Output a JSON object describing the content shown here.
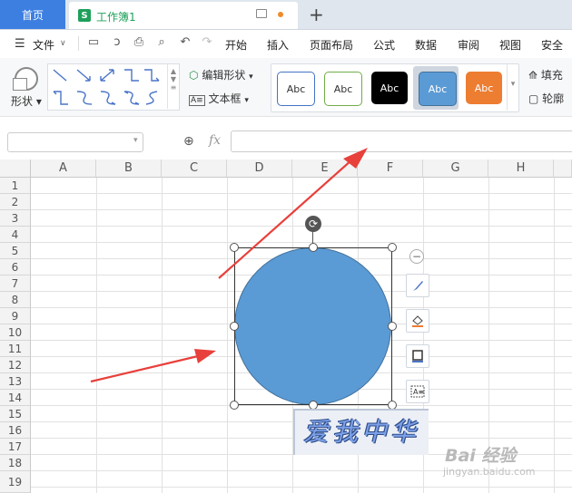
{
  "titlebar": {
    "home_tab": "首页",
    "doc_icon": "S",
    "doc_title": "工作簿1",
    "new_tab_symbol": "+"
  },
  "menubar": {
    "file_label": "文件",
    "items": [
      "开始",
      "插入",
      "页面布局",
      "公式",
      "数据",
      "审阅",
      "视图",
      "安全"
    ]
  },
  "ribbon": {
    "shape_label": "形状",
    "edit_shape_label": "编辑形状",
    "textbox_label": "文本框",
    "style_samples": [
      "Abc",
      "Abc",
      "Abc",
      "Abc",
      "Abc"
    ],
    "style_colors": {
      "style1_border": "#4472c4",
      "style2_border": "#70ad47",
      "style3_fill": "#000000",
      "style4_fill": "#5b9bd5",
      "style5_fill": "#ed7d31"
    },
    "fill_label": "填充",
    "outline_label": "轮廓"
  },
  "formula_bar": {
    "fx_label": "fx",
    "cell_reference": "",
    "formula_value": ""
  },
  "grid": {
    "columns": [
      "A",
      "B",
      "C",
      "D",
      "E",
      "F",
      "G",
      "H"
    ],
    "rows": [
      "1",
      "2",
      "3",
      "4",
      "5",
      "6",
      "7",
      "8",
      "9",
      "10",
      "11",
      "12",
      "13",
      "14",
      "15",
      "16",
      "17",
      "18",
      "19"
    ]
  },
  "shape": {
    "type": "circle",
    "fill": "#5b9bd5",
    "outline": "#41719c"
  },
  "watermark": {
    "text": "爱我中华",
    "baidu_text": "Bai 经验",
    "baidu_url": "jingyan.baidu.com"
  },
  "annotations": {
    "arrow_color": "#e8403b"
  }
}
